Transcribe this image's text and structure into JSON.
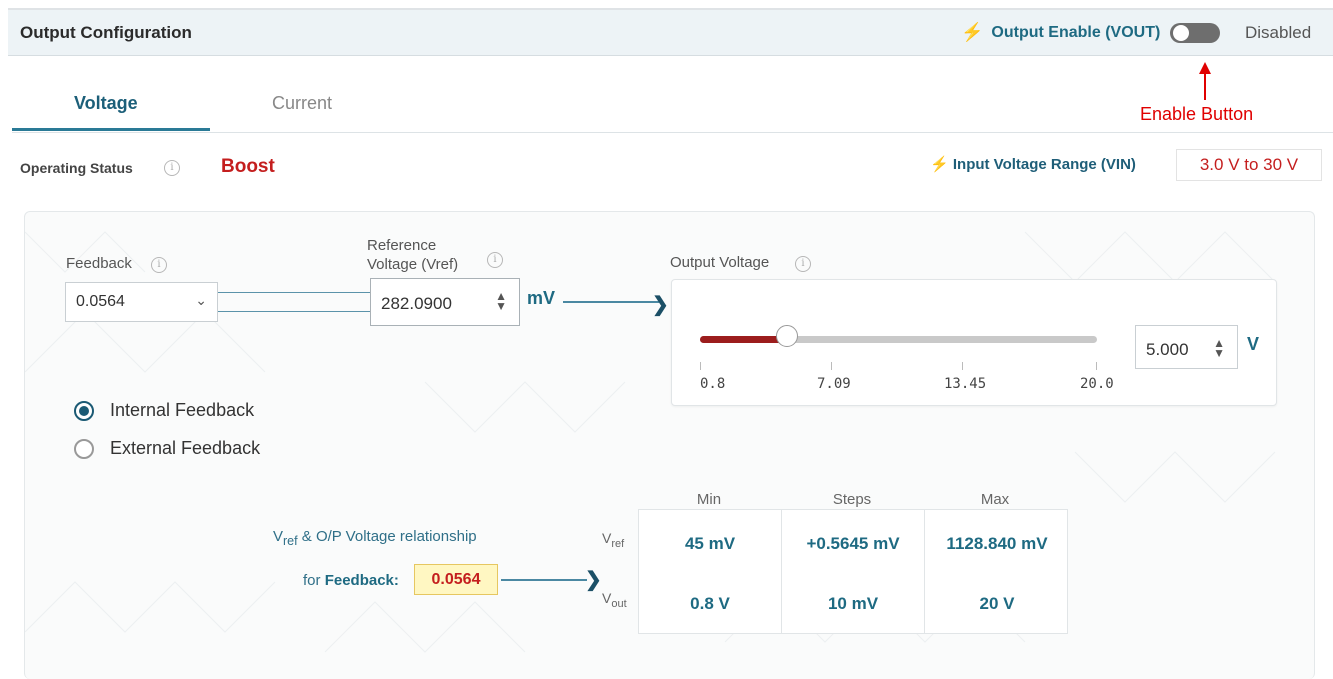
{
  "header": {
    "title": "Output Configuration",
    "output_enable_label": "Output Enable (VOUT)",
    "output_enable_status": "Disabled"
  },
  "annotation": {
    "text": "Enable Button",
    "color": "#e00000"
  },
  "tabs": [
    {
      "label": "Voltage",
      "active": true
    },
    {
      "label": "Current",
      "active": false
    }
  ],
  "operating_status": {
    "label": "Operating Status",
    "value": "Boost"
  },
  "input_voltage_range": {
    "label": "Input Voltage Range (VIN)",
    "value": "3.0 V to 30 V"
  },
  "feedback": {
    "label": "Feedback",
    "value": "0.0564"
  },
  "reference_voltage": {
    "label_line1": "Reference",
    "label_line2": "Voltage (Vref)",
    "value": "282.0900",
    "unit": "mV"
  },
  "output_voltage": {
    "label": "Output Voltage",
    "value": "5.000",
    "unit": "V",
    "slider": {
      "min": 0.8,
      "max": 20.0,
      "value": 5.0,
      "ticks": [
        "0.8",
        "7.09",
        "13.45",
        "20.0"
      ]
    }
  },
  "feedback_mode": {
    "options": [
      "Internal Feedback",
      "External Feedback"
    ],
    "selected": "Internal Feedback"
  },
  "relationship": {
    "title_vref": "V",
    "title_vref_sub": "ref",
    "title_rest": " & O/P Voltage relationship",
    "for_label": "for",
    "feedback_label": "Feedback:",
    "feedback_value": "0.0564",
    "columns": [
      "Min",
      "Steps",
      "Max"
    ],
    "rows": [
      {
        "label": "V",
        "sub": "ref",
        "values": [
          "45 mV",
          "+0.5645 mV",
          "1128.840 mV"
        ]
      },
      {
        "label": "V",
        "sub": "out",
        "values": [
          "0.8 V",
          "10 mV",
          "20 V"
        ]
      }
    ]
  },
  "colors": {
    "accent": "#1e6a82",
    "status_red": "#c41e1e",
    "slider_fill": "#9c1d1d"
  }
}
